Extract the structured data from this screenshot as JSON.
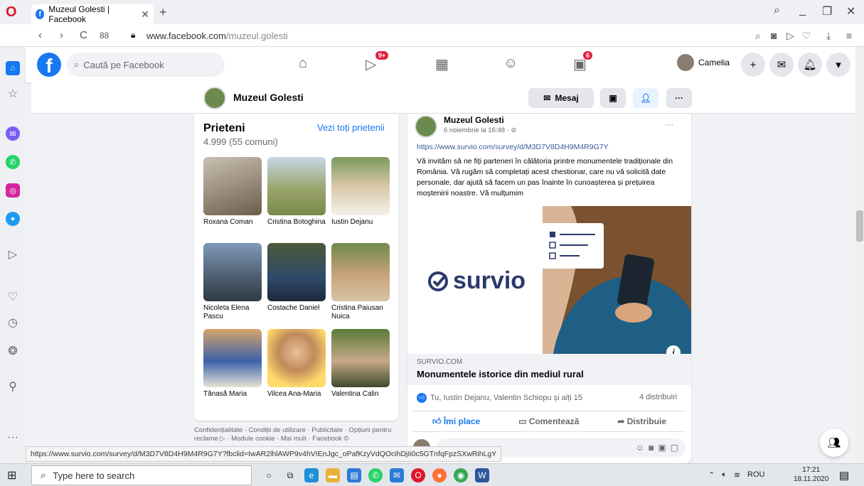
{
  "browser": {
    "tab_title": "Muzeul Golesti | Facebook",
    "tab_close": "✕",
    "new_tab": "+",
    "url_host": "www.facebook.com",
    "url_path": "/muzeul.golesti",
    "status_url": "https://www.survio.com/survey/d/M3D7V8D4H9M4R9G7Y?fbclid=IwAR2lhlAWP9v4hVIEnJgc_oPafKzyVdQOcihDjIi0c5GTnfqFpzSXwRihLgY"
  },
  "fbnav": {
    "search_placeholder": "Caută pe Facebook",
    "watch_badge": "9+",
    "gaming_badge": "6",
    "profile_name": "Camelia"
  },
  "page_header": {
    "name": "Muzeul Golesti",
    "message_button": "Mesaj",
    "more": "···"
  },
  "friends": {
    "title": "Prieteni",
    "see_all": "Vezi toți prietenii",
    "count": "4.999 (55 comuni)",
    "list": [
      {
        "name": "Roxana Coman"
      },
      {
        "name": "Cristina Botoghina"
      },
      {
        "name": "Iustin Dejanu"
      },
      {
        "name": "Nicoleta Elena Pascu"
      },
      {
        "name": "Costache Daniel"
      },
      {
        "name": "Cristina Paiusan Nuica"
      },
      {
        "name": "Tănasă Maria"
      },
      {
        "name": "Vilcea Ana-Maria"
      },
      {
        "name": "Valentina Calin"
      }
    ]
  },
  "legal": "Confidențialitate · Condiții de utilizare · Publicitate · Opțiuni pentru reclame ▷ · Module cookie · Mai mult · Facebook ©",
  "post": {
    "author": "Muzeul Golesti",
    "time": "6 noiembrie la 16:48 · ⊘",
    "more": "···",
    "link": "https://www.survio.com/survey/d/M3D7V8D4H9M4R9G7Y",
    "text": "Vă invităm să ne fiți parteneri în călătoria printre monumentele tradiționale din România. Vă rugăm să completați acest chestionar, care nu vă solicită date personale, dar ajută să facem un pas înainte în cunoașterea și prețuirea moștenirii noastre. Vă mulțumim",
    "image_logo": "survio",
    "link_domain": "SURVIO.COM",
    "link_title": "Monumentele istorice din mediul rural",
    "reactions": "Tu, Iustin Dejanu, Valentin Schiopu și alți 15",
    "shares": "4 distribuiri",
    "like": "Îmi place",
    "comment": "Comentează",
    "share": "Distribuie"
  },
  "taskbar": {
    "search_placeholder": "Type here to search",
    "lang": "ROU",
    "time": "17:21",
    "date": "18.11.2020"
  },
  "colors": {
    "facebook_blue": "#1877f2",
    "badge_red": "#e41e3f",
    "survio_navy": "#2b3a6b",
    "survio_green": "#3fae7a"
  }
}
